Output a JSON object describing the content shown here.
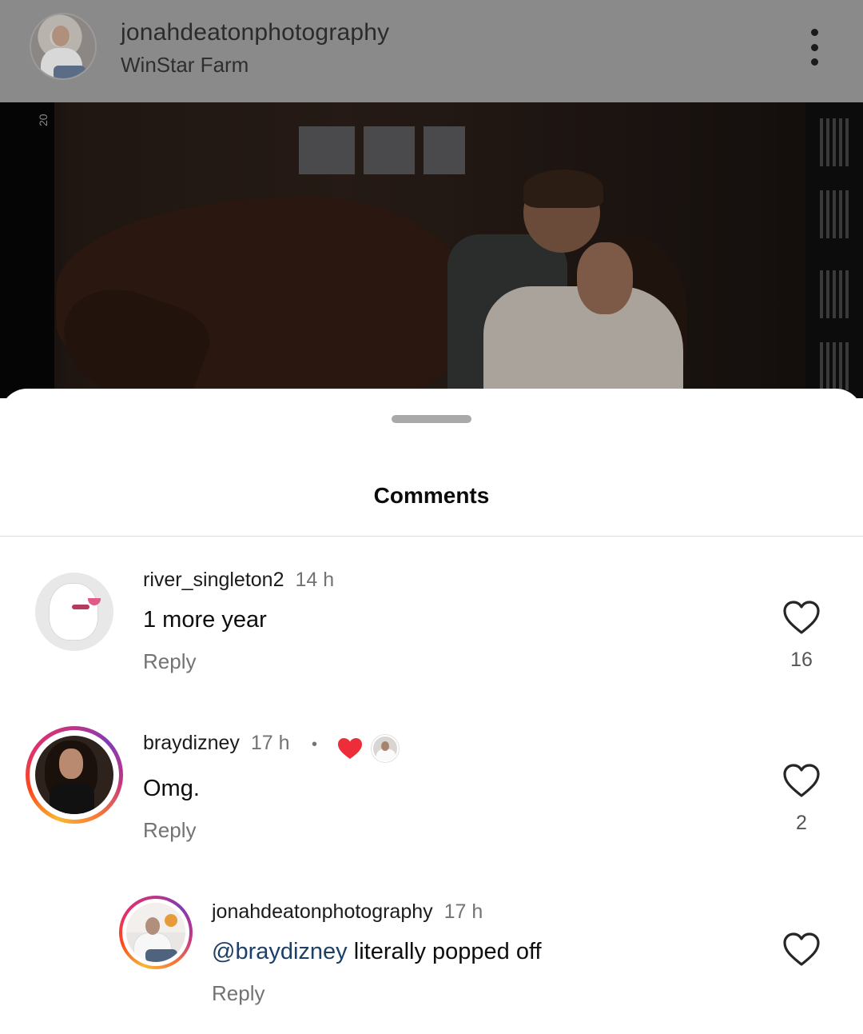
{
  "post": {
    "username": "jonahdeatonphotography",
    "location": "WinStar Farm",
    "film_frame_number": "20"
  },
  "comments_sheet": {
    "title": "Comments",
    "comments": [
      {
        "username": "river_singleton2",
        "time": "14 h",
        "text": "1 more year",
        "reply_label": "Reply",
        "like_count": "16"
      },
      {
        "username": "braydizney",
        "time": "17 h",
        "separator": "•",
        "text": "Omg.",
        "reply_label": "Reply",
        "like_count": "2"
      },
      {
        "username": "jonahdeatonphotography",
        "time": "17 h",
        "mention": "@braydizney",
        "text": " literally popped off",
        "reply_label": "Reply"
      }
    ]
  },
  "colors": {
    "heart_red": "#ed2d3a",
    "mention_blue": "#1e3f66",
    "secondary_text": "#737373"
  }
}
